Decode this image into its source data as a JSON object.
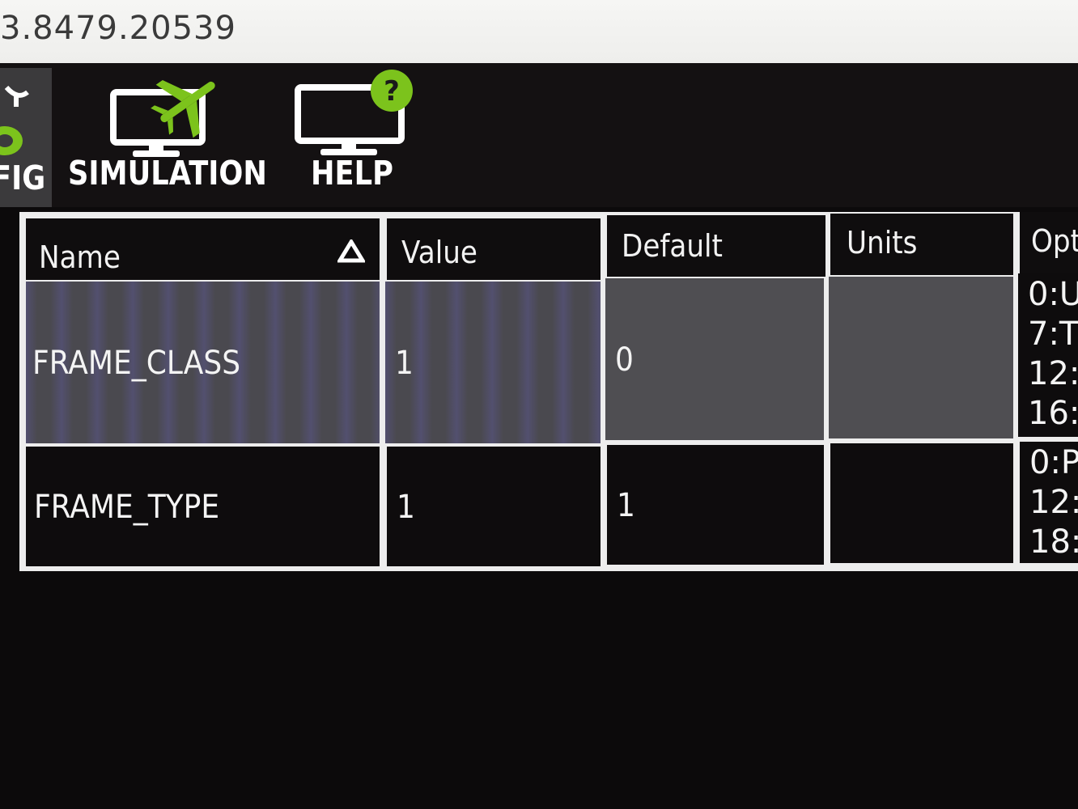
{
  "window": {
    "title": "3.8479.20539"
  },
  "toolbar": {
    "config_label": "FIG",
    "simulation_label": "SIMULATION",
    "help_label": "HELP"
  },
  "table": {
    "columns": [
      "Name",
      "Value",
      "Default",
      "Units",
      "Opt"
    ],
    "rows": [
      {
        "name": "FRAME_CLASS",
        "value": "1",
        "default": "0",
        "units": "",
        "options": [
          "0:U",
          "7:T",
          "12:",
          "16:"
        ]
      },
      {
        "name": "FRAME_TYPE",
        "value": "1",
        "default": "1",
        "units": "",
        "options": [
          "0:P",
          "12:",
          "18:"
        ]
      }
    ]
  },
  "icons": {
    "sort": "sort-ascending-triangle-icon",
    "simulation": "monitor-airplane-icon",
    "help": "monitor-help-icon",
    "config": "config-icon"
  },
  "colors": {
    "accent_green": "#7cc31c",
    "background": "#0c0a0b",
    "row_highlight": "#4f4e52"
  }
}
